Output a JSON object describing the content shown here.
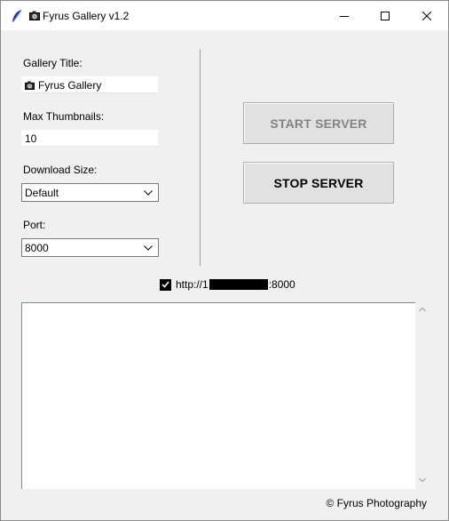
{
  "window": {
    "title": "Fyrus Gallery v1.2",
    "icon": "feather-icon"
  },
  "form": {
    "gallery_title_label": "Gallery Title:",
    "gallery_title_value": "Fyrus Gallery",
    "max_thumbnails_label": "Max Thumbnails:",
    "max_thumbnails_value": "10",
    "download_size_label": "Download Size:",
    "download_size_value": "Default",
    "port_label": "Port:",
    "port_value": "8000"
  },
  "buttons": {
    "start_label": "START SERVER",
    "start_enabled": false,
    "stop_label": "STOP SERVER",
    "stop_enabled": true
  },
  "server": {
    "checked": true,
    "url_prefix": "http://1",
    "url_suffix": ":8000"
  },
  "log": {
    "text": ""
  },
  "footer": {
    "copyright": "© Fyrus Photography"
  },
  "colors": {
    "window_bg": "#f0f0f0",
    "titlebar_bg": "#ffffff",
    "button_bg": "#e1e1e1",
    "disabled_text": "#838383"
  }
}
